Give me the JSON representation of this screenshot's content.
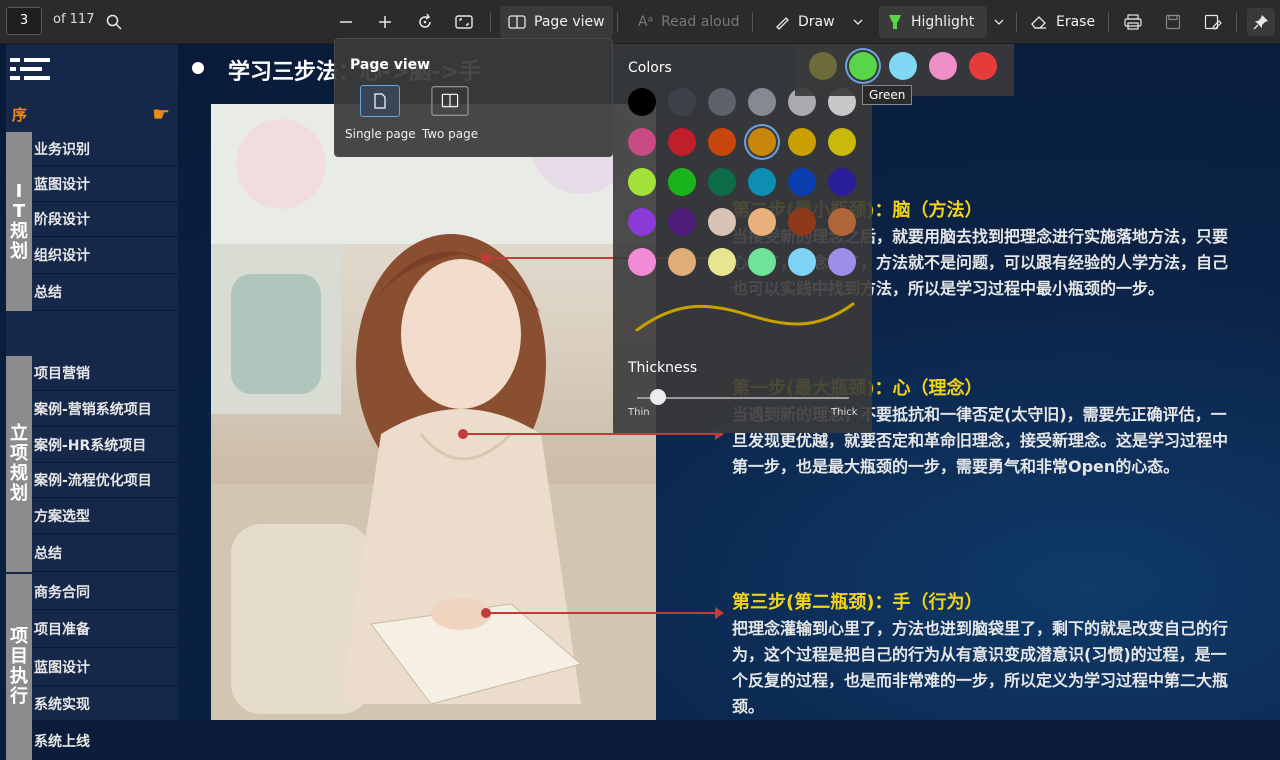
{
  "toolbar": {
    "page_current": "3",
    "page_total": "of 117",
    "page_view_label": "Page view",
    "read_aloud_label": "Read aloud",
    "draw_label": "Draw",
    "highlight_label": "Highlight",
    "erase_label": "Erase"
  },
  "sidebar": {
    "preface": "序",
    "groups": [
      {
        "label": "IT规划",
        "items": [
          "业务识别",
          "蓝图设计",
          "阶段设计",
          "组织设计",
          "总结"
        ]
      },
      {
        "label": "立项规划",
        "items": [
          "项目营销",
          "案例-营销系统项目",
          "案例-HR系统项目",
          "案例-流程优化项目",
          "方案选型",
          "总结"
        ]
      },
      {
        "label": "项目执行",
        "items": [
          "商务合同",
          "项目准备",
          "蓝图设计",
          "系统实现",
          "系统上线"
        ]
      }
    ]
  },
  "slide": {
    "title": "学习三步法：心->脑->手",
    "steps": [
      {
        "heading": "第二步(最小瓶颈)：脑（方法）",
        "text": "当接受新的理念之后，就要用脑去找到把理念进行实施落地方法，只要心到了，理念到了，方法就不是问题，可以跟有经验的人学方法，自己也可以实践中找到方法，所以是学习过程中最小瓶颈的一步。"
      },
      {
        "heading": "第一步(最大瓶颈)：心（理念）",
        "text": "当遇到新的理念，不要抵抗和一律否定(太守旧)，需要先正确评估，一旦发现更优越，就要否定和革命旧理念，接受新理念。这是学习过程中第一步，也是最大瓶颈的一步，需要勇气和非常Open的心态。"
      },
      {
        "heading": "第三步(第二瓶颈)：手（行为）",
        "text": "把理念灌输到心里了，方法也进到脑袋里了，剩下的就是改变自己的行为，这个过程是把自己的行为从有意识变成潜意识(习惯)的过程，是一个反复的过程，也是而非常难的一步，所以定义为学习过程中第二大瓶颈。"
      }
    ]
  },
  "page_view_panel": {
    "title": "Page view",
    "options": [
      "Single page",
      "Two page"
    ],
    "selected": "Single page"
  },
  "colors_panel": {
    "title": "Colors",
    "selected_color": "#c8860c",
    "rows": [
      [
        "#000000",
        "#3d4148",
        "#5e636b",
        "#858990",
        "#a9abaf",
        "#c8c8c8"
      ],
      [
        "#c84b86",
        "#c11e2a",
        "#c8470e",
        "#c8860c",
        "#c9a000",
        "#c8b90a"
      ],
      [
        "#a2e23a",
        "#1bb31b",
        "#0e6b48",
        "#0e8eb0",
        "#0b3fb0",
        "#2b1e9b"
      ],
      [
        "#8a3ad6",
        "#4f1d7a",
        "#d8c3b4",
        "#e8b07a",
        "#8e3a1a",
        "#b0653a"
      ],
      [
        "#f38ad8",
        "#e0ad7a",
        "#e8e590",
        "#6fe39a",
        "#7fd3f5",
        "#9b8fe8"
      ]
    ],
    "thickness_label": "Thickness",
    "thin_label": "Thin",
    "thick_label": "Thick",
    "thickness_value": 0.1,
    "preview_color": "#c8a000"
  },
  "highlight_panel": {
    "colors": [
      "#6b6b3c",
      "#58d64a",
      "#80d8f5",
      "#f08ec8",
      "#e63b3b"
    ],
    "selected": "#58d64a",
    "tooltip": "Green"
  }
}
